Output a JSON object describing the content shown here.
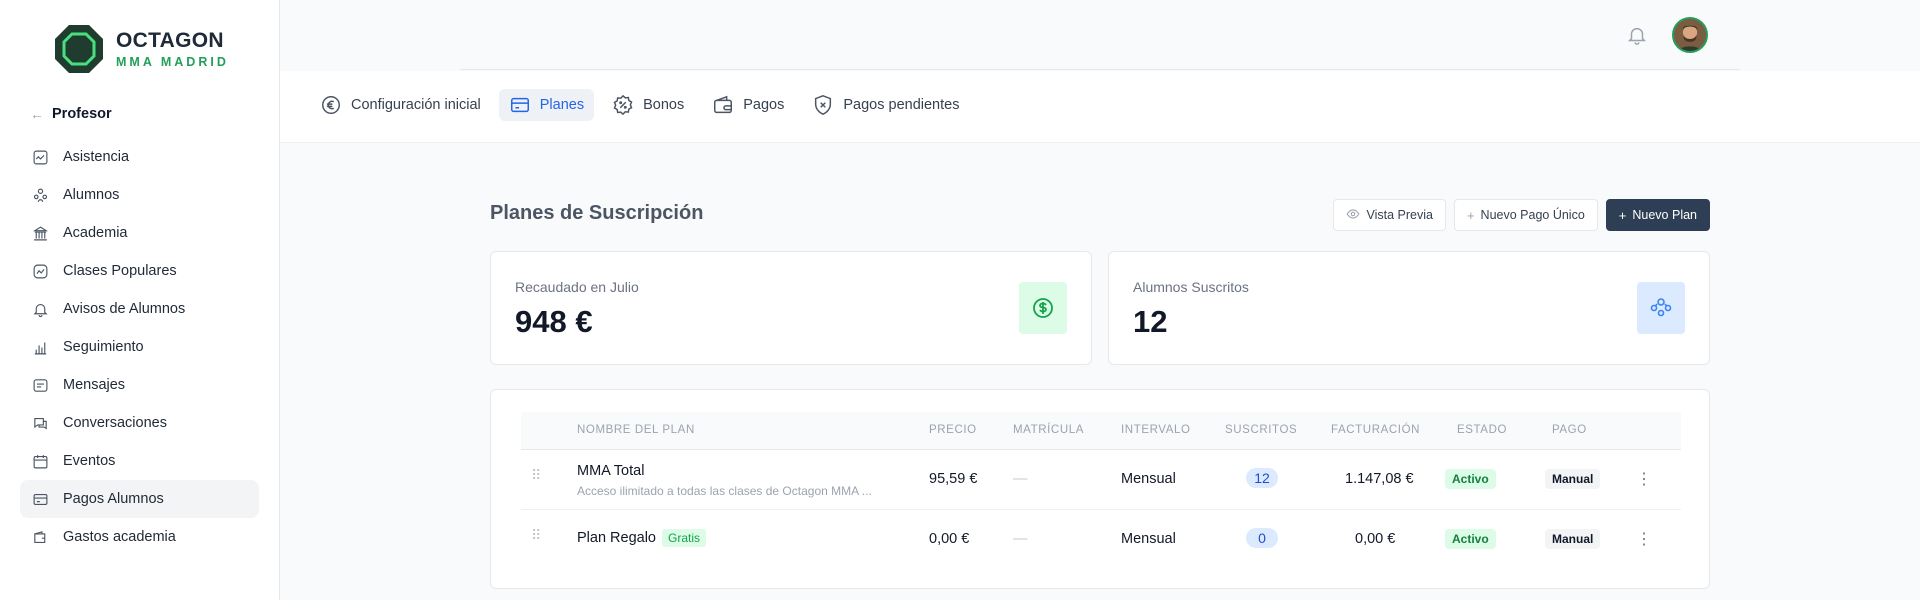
{
  "brand": {
    "name": "OCTAGON",
    "subtitle": "MMA MADRID"
  },
  "sidebar": {
    "back_label": "Profesor",
    "items": [
      {
        "label": "Asistencia",
        "icon": "activity-icon"
      },
      {
        "label": "Alumnos",
        "icon": "users-icon"
      },
      {
        "label": "Academia",
        "icon": "building-icon"
      },
      {
        "label": "Clases Populares",
        "icon": "trend-icon"
      },
      {
        "label": "Avisos de Alumnos",
        "icon": "bell-icon"
      },
      {
        "label": "Seguimiento",
        "icon": "bar-chart-icon"
      },
      {
        "label": "Mensajes",
        "icon": "message-icon"
      },
      {
        "label": "Conversaciones",
        "icon": "chat-icon"
      },
      {
        "label": "Eventos",
        "icon": "calendar-icon"
      },
      {
        "label": "Pagos Alumnos",
        "icon": "card-icon",
        "active": true
      },
      {
        "label": "Gastos academia",
        "icon": "wallet-icon"
      }
    ]
  },
  "tabs": [
    {
      "label": "Configuración inicial",
      "icon": "euro-icon"
    },
    {
      "label": "Planes",
      "icon": "card-icon",
      "active": true
    },
    {
      "label": "Bonos",
      "icon": "discount-icon"
    },
    {
      "label": "Pagos",
      "icon": "wallet-icon"
    },
    {
      "label": "Pagos pendientes",
      "icon": "shield-x-icon"
    }
  ],
  "page": {
    "title": "Planes de Suscripción",
    "actions": {
      "preview": "Vista Previa",
      "single_payment": "Nuevo Pago Único",
      "new_plan": "Nuevo Plan"
    }
  },
  "stats": [
    {
      "label": "Recaudado en Julio",
      "value": "948 €",
      "icon": "dollar-circle-icon"
    },
    {
      "label": "Alumnos Suscritos",
      "value": "12",
      "icon": "users-icon"
    }
  ],
  "table": {
    "headers": {
      "name": "NOMBRE DEL PLAN",
      "price": "PRECIO",
      "enrollment": "MATRÍCULA",
      "interval": "INTERVALO",
      "subscribed": "SUSCRITOS",
      "billing": "FACTURACIÓN",
      "status": "ESTADO",
      "payment": "PAGO"
    },
    "rows": [
      {
        "name": "MMA Total",
        "description": "Acceso ilimitado a todas las clases de Octagon MMA ...",
        "badge": "",
        "price": "95,59 €",
        "enrollment": "—",
        "interval": "Mensual",
        "subscribed": "12",
        "billing": "1.147,08 €",
        "status": "Activo",
        "payment": "Manual"
      },
      {
        "name": "Plan Regalo",
        "description": "",
        "badge": "Gratis",
        "price": "0,00 €",
        "enrollment": "—",
        "interval": "Mensual",
        "subscribed": "0",
        "billing": "0,00 €",
        "status": "Activo",
        "payment": "Manual"
      }
    ]
  },
  "colors": {
    "brand_green": "#22a05a",
    "primary_button": "#2e3e54",
    "active_tab": "#2563eb"
  }
}
